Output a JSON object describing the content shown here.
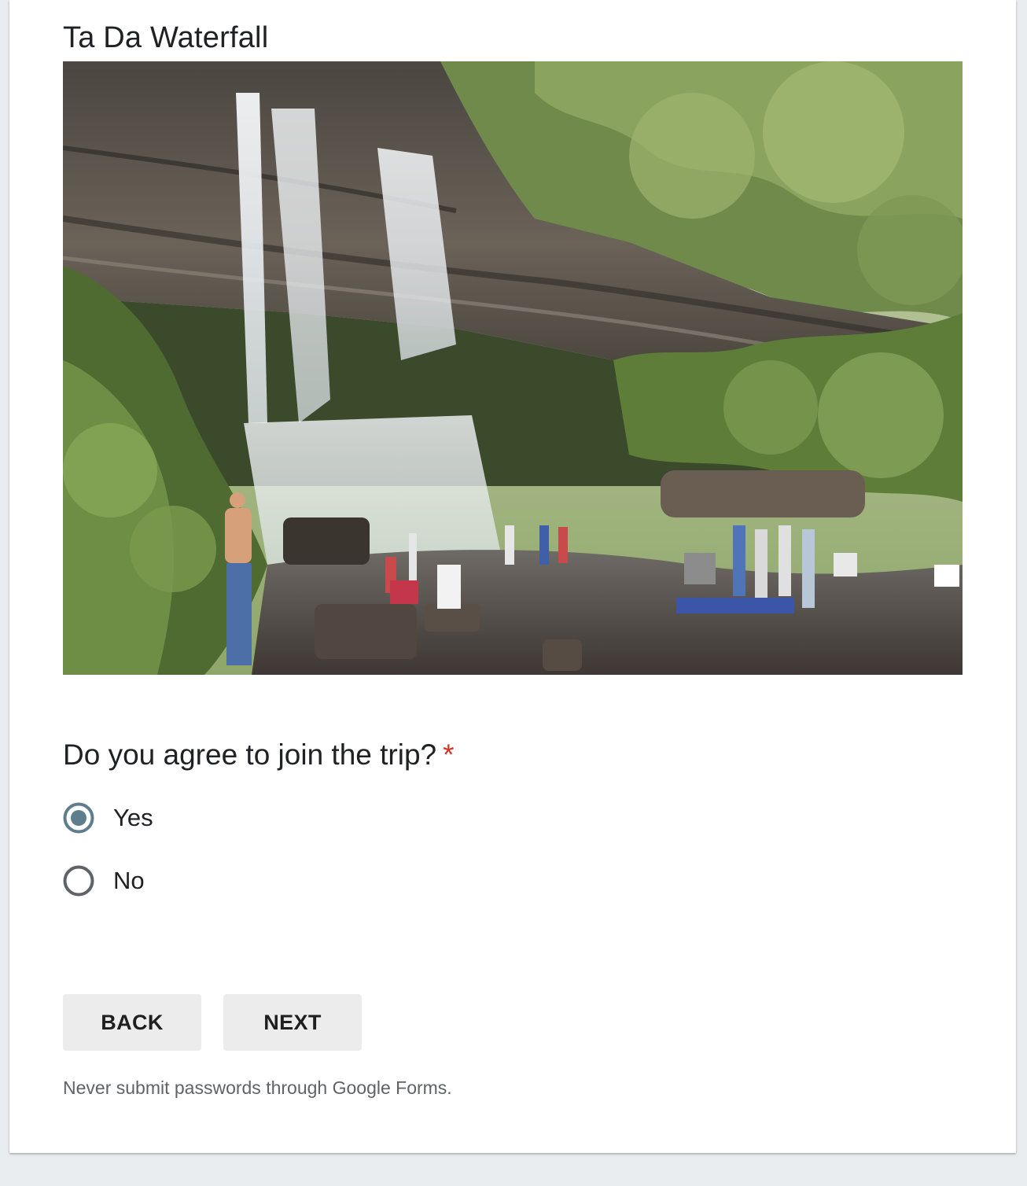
{
  "section": {
    "title": "Ta Da Waterfall"
  },
  "image": {
    "subject": "waterfall-photo"
  },
  "question": {
    "text": "Do you agree to join the trip?",
    "required_marker": "*",
    "options": [
      {
        "label": "Yes",
        "selected": true
      },
      {
        "label": "No",
        "selected": false
      }
    ]
  },
  "buttons": {
    "back_label": "BACK",
    "next_label": "NEXT"
  },
  "footer": {
    "note": "Never submit passwords through Google Forms."
  },
  "colors": {
    "radio_selected": "#5f7d8c",
    "radio_border": "#5f6368",
    "required": "#d93025",
    "button_bg": "#ececec"
  }
}
